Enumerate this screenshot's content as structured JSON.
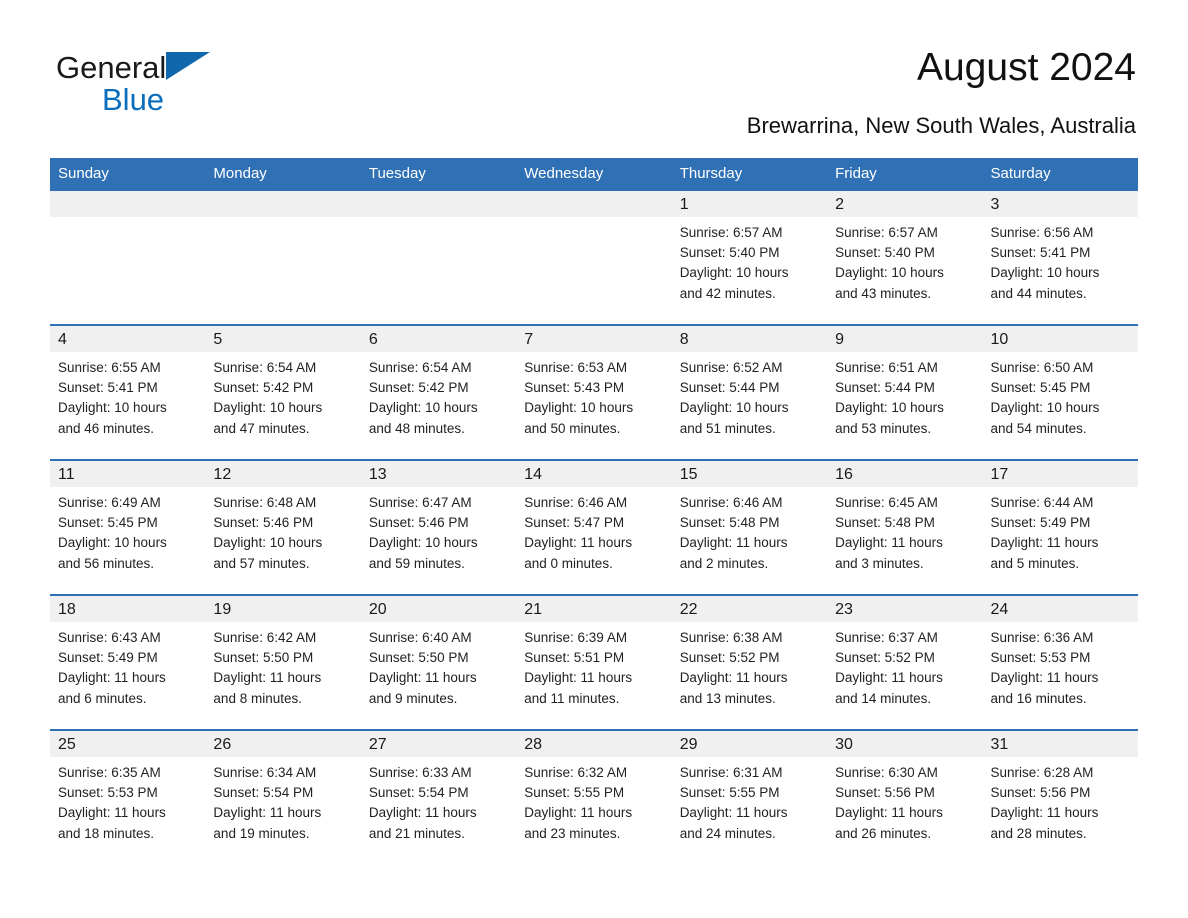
{
  "brand": {
    "name_part1": "General",
    "name_part2": "Blue",
    "logo_icon": "blue-triangle-logo"
  },
  "header": {
    "title": "August 2024",
    "location": "Brewarrina, New South Wales, Australia"
  },
  "colors": {
    "header_blue": "#3071b5",
    "brand_blue": "#0a6ebd",
    "daynum_band": "#f0f0f0",
    "text": "#1a1a1a",
    "page_background": "#ffffff"
  },
  "calendar": {
    "weekday_headers": [
      "Sunday",
      "Monday",
      "Tuesday",
      "Wednesday",
      "Thursday",
      "Friday",
      "Saturday"
    ],
    "weeks": [
      [
        {
          "day": "",
          "empty": true
        },
        {
          "day": "",
          "empty": true
        },
        {
          "day": "",
          "empty": true
        },
        {
          "day": "",
          "empty": true
        },
        {
          "day": "1",
          "sunrise": "Sunrise: 6:57 AM",
          "sunset": "Sunset: 5:40 PM",
          "daylight_line1": "Daylight: 10 hours",
          "daylight_line2": "and 42 minutes."
        },
        {
          "day": "2",
          "sunrise": "Sunrise: 6:57 AM",
          "sunset": "Sunset: 5:40 PM",
          "daylight_line1": "Daylight: 10 hours",
          "daylight_line2": "and 43 minutes."
        },
        {
          "day": "3",
          "sunrise": "Sunrise: 6:56 AM",
          "sunset": "Sunset: 5:41 PM",
          "daylight_line1": "Daylight: 10 hours",
          "daylight_line2": "and 44 minutes."
        }
      ],
      [
        {
          "day": "4",
          "sunrise": "Sunrise: 6:55 AM",
          "sunset": "Sunset: 5:41 PM",
          "daylight_line1": "Daylight: 10 hours",
          "daylight_line2": "and 46 minutes."
        },
        {
          "day": "5",
          "sunrise": "Sunrise: 6:54 AM",
          "sunset": "Sunset: 5:42 PM",
          "daylight_line1": "Daylight: 10 hours",
          "daylight_line2": "and 47 minutes."
        },
        {
          "day": "6",
          "sunrise": "Sunrise: 6:54 AM",
          "sunset": "Sunset: 5:42 PM",
          "daylight_line1": "Daylight: 10 hours",
          "daylight_line2": "and 48 minutes."
        },
        {
          "day": "7",
          "sunrise": "Sunrise: 6:53 AM",
          "sunset": "Sunset: 5:43 PM",
          "daylight_line1": "Daylight: 10 hours",
          "daylight_line2": "and 50 minutes."
        },
        {
          "day": "8",
          "sunrise": "Sunrise: 6:52 AM",
          "sunset": "Sunset: 5:44 PM",
          "daylight_line1": "Daylight: 10 hours",
          "daylight_line2": "and 51 minutes."
        },
        {
          "day": "9",
          "sunrise": "Sunrise: 6:51 AM",
          "sunset": "Sunset: 5:44 PM",
          "daylight_line1": "Daylight: 10 hours",
          "daylight_line2": "and 53 minutes."
        },
        {
          "day": "10",
          "sunrise": "Sunrise: 6:50 AM",
          "sunset": "Sunset: 5:45 PM",
          "daylight_line1": "Daylight: 10 hours",
          "daylight_line2": "and 54 minutes."
        }
      ],
      [
        {
          "day": "11",
          "sunrise": "Sunrise: 6:49 AM",
          "sunset": "Sunset: 5:45 PM",
          "daylight_line1": "Daylight: 10 hours",
          "daylight_line2": "and 56 minutes."
        },
        {
          "day": "12",
          "sunrise": "Sunrise: 6:48 AM",
          "sunset": "Sunset: 5:46 PM",
          "daylight_line1": "Daylight: 10 hours",
          "daylight_line2": "and 57 minutes."
        },
        {
          "day": "13",
          "sunrise": "Sunrise: 6:47 AM",
          "sunset": "Sunset: 5:46 PM",
          "daylight_line1": "Daylight: 10 hours",
          "daylight_line2": "and 59 minutes."
        },
        {
          "day": "14",
          "sunrise": "Sunrise: 6:46 AM",
          "sunset": "Sunset: 5:47 PM",
          "daylight_line1": "Daylight: 11 hours",
          "daylight_line2": "and 0 minutes."
        },
        {
          "day": "15",
          "sunrise": "Sunrise: 6:46 AM",
          "sunset": "Sunset: 5:48 PM",
          "daylight_line1": "Daylight: 11 hours",
          "daylight_line2": "and 2 minutes."
        },
        {
          "day": "16",
          "sunrise": "Sunrise: 6:45 AM",
          "sunset": "Sunset: 5:48 PM",
          "daylight_line1": "Daylight: 11 hours",
          "daylight_line2": "and 3 minutes."
        },
        {
          "day": "17",
          "sunrise": "Sunrise: 6:44 AM",
          "sunset": "Sunset: 5:49 PM",
          "daylight_line1": "Daylight: 11 hours",
          "daylight_line2": "and 5 minutes."
        }
      ],
      [
        {
          "day": "18",
          "sunrise": "Sunrise: 6:43 AM",
          "sunset": "Sunset: 5:49 PM",
          "daylight_line1": "Daylight: 11 hours",
          "daylight_line2": "and 6 minutes."
        },
        {
          "day": "19",
          "sunrise": "Sunrise: 6:42 AM",
          "sunset": "Sunset: 5:50 PM",
          "daylight_line1": "Daylight: 11 hours",
          "daylight_line2": "and 8 minutes."
        },
        {
          "day": "20",
          "sunrise": "Sunrise: 6:40 AM",
          "sunset": "Sunset: 5:50 PM",
          "daylight_line1": "Daylight: 11 hours",
          "daylight_line2": "and 9 minutes."
        },
        {
          "day": "21",
          "sunrise": "Sunrise: 6:39 AM",
          "sunset": "Sunset: 5:51 PM",
          "daylight_line1": "Daylight: 11 hours",
          "daylight_line2": "and 11 minutes."
        },
        {
          "day": "22",
          "sunrise": "Sunrise: 6:38 AM",
          "sunset": "Sunset: 5:52 PM",
          "daylight_line1": "Daylight: 11 hours",
          "daylight_line2": "and 13 minutes."
        },
        {
          "day": "23",
          "sunrise": "Sunrise: 6:37 AM",
          "sunset": "Sunset: 5:52 PM",
          "daylight_line1": "Daylight: 11 hours",
          "daylight_line2": "and 14 minutes."
        },
        {
          "day": "24",
          "sunrise": "Sunrise: 6:36 AM",
          "sunset": "Sunset: 5:53 PM",
          "daylight_line1": "Daylight: 11 hours",
          "daylight_line2": "and 16 minutes."
        }
      ],
      [
        {
          "day": "25",
          "sunrise": "Sunrise: 6:35 AM",
          "sunset": "Sunset: 5:53 PM",
          "daylight_line1": "Daylight: 11 hours",
          "daylight_line2": "and 18 minutes."
        },
        {
          "day": "26",
          "sunrise": "Sunrise: 6:34 AM",
          "sunset": "Sunset: 5:54 PM",
          "daylight_line1": "Daylight: 11 hours",
          "daylight_line2": "and 19 minutes."
        },
        {
          "day": "27",
          "sunrise": "Sunrise: 6:33 AM",
          "sunset": "Sunset: 5:54 PM",
          "daylight_line1": "Daylight: 11 hours",
          "daylight_line2": "and 21 minutes."
        },
        {
          "day": "28",
          "sunrise": "Sunrise: 6:32 AM",
          "sunset": "Sunset: 5:55 PM",
          "daylight_line1": "Daylight: 11 hours",
          "daylight_line2": "and 23 minutes."
        },
        {
          "day": "29",
          "sunrise": "Sunrise: 6:31 AM",
          "sunset": "Sunset: 5:55 PM",
          "daylight_line1": "Daylight: 11 hours",
          "daylight_line2": "and 24 minutes."
        },
        {
          "day": "30",
          "sunrise": "Sunrise: 6:30 AM",
          "sunset": "Sunset: 5:56 PM",
          "daylight_line1": "Daylight: 11 hours",
          "daylight_line2": "and 26 minutes."
        },
        {
          "day": "31",
          "sunrise": "Sunrise: 6:28 AM",
          "sunset": "Sunset: 5:56 PM",
          "daylight_line1": "Daylight: 11 hours",
          "daylight_line2": "and 28 minutes."
        }
      ]
    ]
  }
}
